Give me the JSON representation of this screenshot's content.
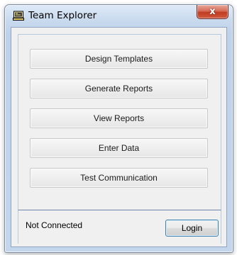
{
  "window": {
    "title": "Team Explorer",
    "icon": "team-explorer-app-icon",
    "close_label": "x"
  },
  "menu": {
    "buttons": [
      {
        "label": "Design Templates"
      },
      {
        "label": "Generate Reports"
      },
      {
        "label": "View Reports"
      },
      {
        "label": "Enter Data"
      },
      {
        "label": "Test Communication"
      }
    ]
  },
  "status": {
    "text": "Not Connected",
    "login_label": "Login"
  },
  "colors": {
    "close_button": "#c13c22",
    "login_border": "#3c7fb1",
    "frame": "#c4d6ec"
  }
}
